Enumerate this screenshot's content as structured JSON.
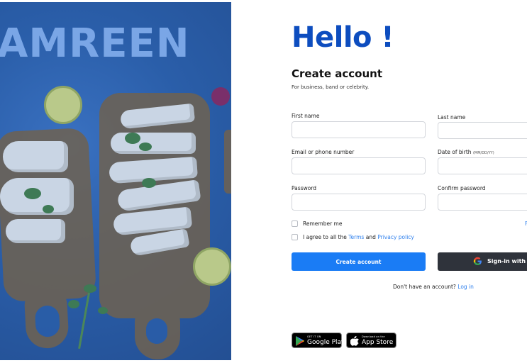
{
  "hero": {
    "brand_text": "AMREEN"
  },
  "form": {
    "greeting": "Hello !",
    "title": "Create account",
    "subtitle": "For business, band or celebrity.",
    "fields": {
      "first_name_label": "First name",
      "last_name_label": "Last name",
      "email_label": "Email or phone number",
      "dob_label": "Date of birth",
      "dob_hint": "(MM/DD/YY)",
      "password_label": "Password",
      "confirm_password_label": "Confirm password",
      "first_name_value": "",
      "last_name_value": "",
      "email_value": "",
      "dob_value": "",
      "password_value": "",
      "confirm_password_value": ""
    },
    "remember_me_label": "Remember me",
    "forgot_partial": "F",
    "agree_prefix": "I agree to all the",
    "terms_link": "Terms",
    "agree_and": "and",
    "privacy_link": "Privacy policy",
    "create_button": "Create account",
    "google_button": "Sign-in with goo",
    "no_account_text": "Don't have an account?",
    "login_link": "Log in"
  },
  "stores": {
    "google_play_small": "GET IT ON",
    "google_play_big": "Google Play",
    "app_store_small": "Download on the",
    "app_store_big": "App Store"
  },
  "colors": {
    "brand_blue": "#0d4dbf",
    "primary_button": "#1a7cf5",
    "google_button": "#2f333b",
    "link": "#2f80ed",
    "hero_overlay": "#2a5ea9"
  }
}
